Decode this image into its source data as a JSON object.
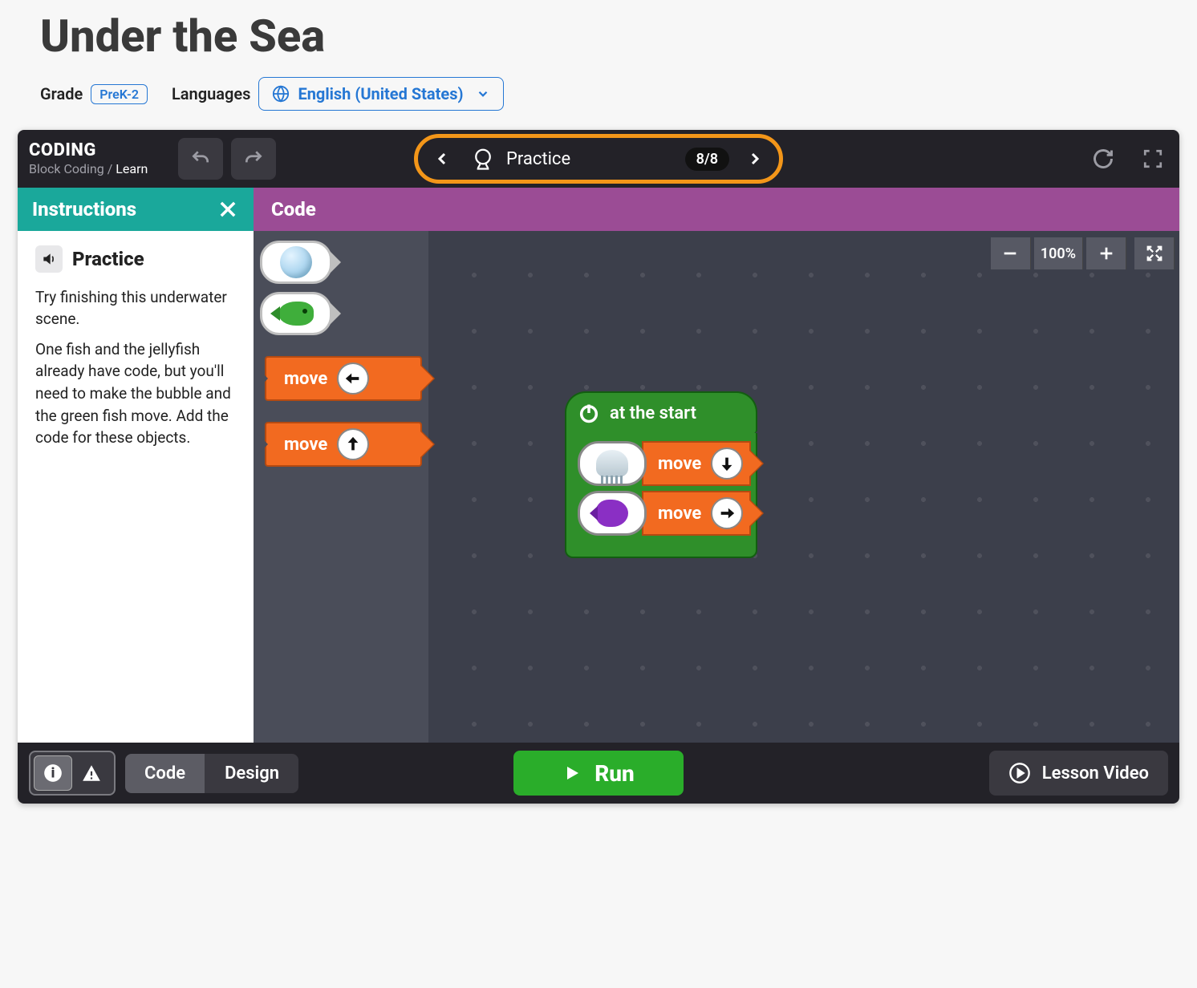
{
  "header": {
    "title": "Under the Sea",
    "grade_label": "Grade",
    "grade_value": "PreK-2",
    "languages_label": "Languages",
    "language_selected": "English (United States)"
  },
  "topbar": {
    "coding": "CODING",
    "breadcrumb_parent": "Block Coding",
    "breadcrumb_sep": " / ",
    "breadcrumb_current": "Learn",
    "step_label": "Practice",
    "step_counter": "8/8"
  },
  "instructions": {
    "panel_title": "Instructions",
    "step_title": "Practice",
    "p1": "Try finishing this underwater scene.",
    "p2": "One fish and the jellyfish already have code, but you'll need to make the bubble and the green fish move. Add the code for these objects."
  },
  "code": {
    "panel_title": "Code",
    "zoom": "100%",
    "palette_blocks": [
      {
        "label": "move",
        "direction": "left"
      },
      {
        "label": "move",
        "direction": "up"
      }
    ],
    "start_label": "at the start",
    "script_rows": [
      {
        "object": "jellyfish",
        "label": "move",
        "direction": "down"
      },
      {
        "object": "purple-fish",
        "label": "move",
        "direction": "right"
      }
    ]
  },
  "footer": {
    "mode_code": "Code",
    "mode_design": "Design",
    "run": "Run",
    "lesson_video": "Lesson Video"
  }
}
